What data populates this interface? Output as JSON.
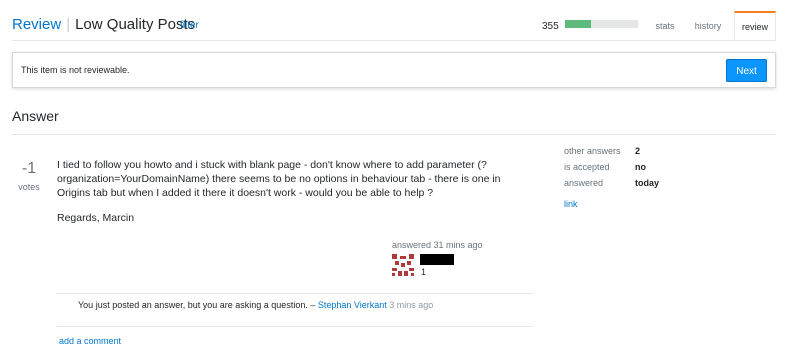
{
  "header": {
    "review_label": "Review",
    "queue_name": "Low Quality Posts",
    "filter_label": "filter",
    "progress_count": "355",
    "progress_fraction": 0.36,
    "tabs": [
      {
        "label": "stats"
      },
      {
        "label": "history"
      },
      {
        "label": "review",
        "active": true
      }
    ]
  },
  "notice": {
    "text": "This item is not reviewable.",
    "next_label": "Next"
  },
  "section": {
    "title": "Answer"
  },
  "post": {
    "vote_count": "-1",
    "vote_label": "votes",
    "body": "I tied to follow you howto and i stuck with blank page - don't know where to add parameter (?organization=YourDomainName) there seems to be no options in behaviour tab - there is one in Origins tab but when I added it there it doesn't work - would you be able to help ?",
    "signoff": "Regards, Marcin",
    "user_action": "answered 31 mins ago",
    "reputation": "1"
  },
  "comment": {
    "text": "You just posted an answer, but you are asking a question. – ",
    "author": "Stephan Vierkant",
    "time": " 3 mins ago",
    "add_label": "add a comment"
  },
  "sidebar": {
    "rows": [
      {
        "label": "other answers",
        "value": "2"
      },
      {
        "label": "is accepted",
        "value": "no"
      },
      {
        "label": "answered",
        "value": "today"
      }
    ],
    "link_label": "link"
  },
  "colors": {
    "link_blue": "#0077cc",
    "button_blue": "#0a95ff",
    "progress_green": "#5eba7d",
    "active_tab_orange": "#f48024"
  }
}
